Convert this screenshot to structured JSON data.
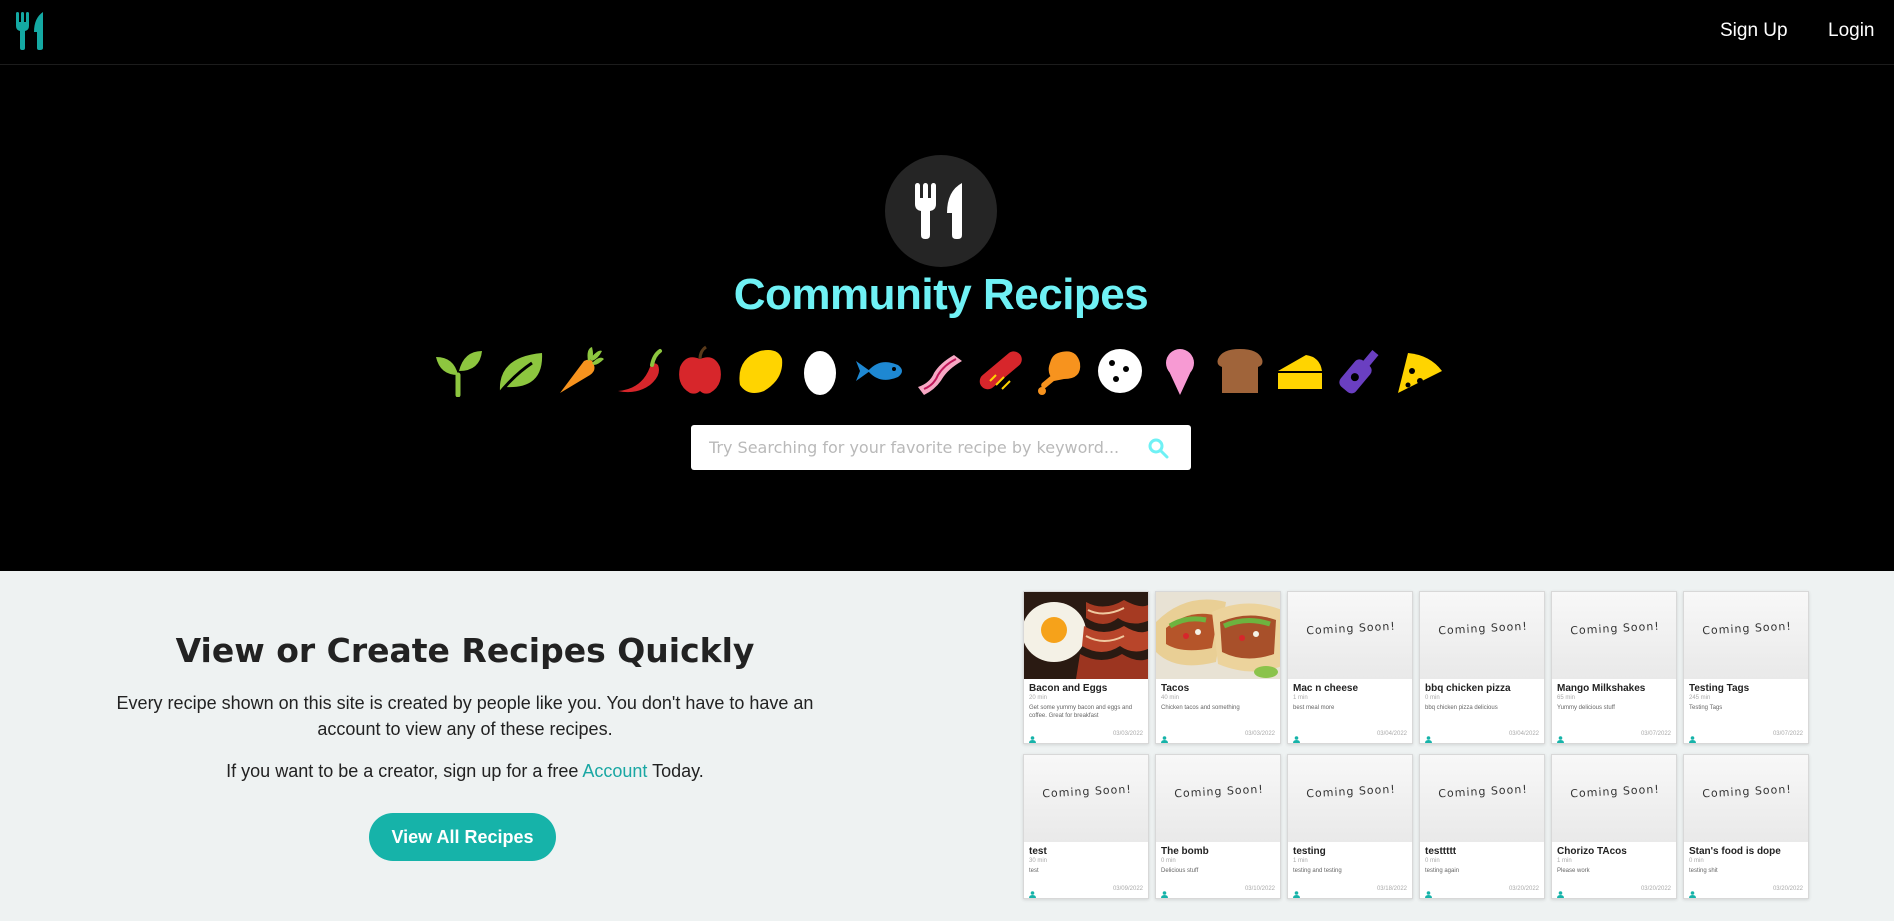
{
  "nav": {
    "signup_label": "Sign Up",
    "login_label": "Login"
  },
  "hero": {
    "title": "Community Recipes",
    "food_icons": [
      "sprout-icon",
      "leaf-icon",
      "carrot-icon",
      "chili-pepper-icon",
      "apple-icon",
      "lemon-icon",
      "egg-icon",
      "fish-icon",
      "bacon-icon",
      "hotdog-icon",
      "drumstick-icon",
      "cookie-icon",
      "ice-cream-icon",
      "bread-icon",
      "cheese-icon",
      "bottle-icon",
      "pizza-slice-icon"
    ]
  },
  "search": {
    "placeholder": "Try Searching for your favorite recipe by keyword..."
  },
  "section": {
    "title": "View or Create Recipes Quickly",
    "description": "Every recipe shown on this site is created by people like you. You don't have to have an account to view any of these recipes.",
    "cta_before": "If you want to be a creator, sign up for a free ",
    "cta_link": "Account",
    "cta_after": " Today.",
    "button_label": "View All Recipes"
  },
  "colors": {
    "accent": "#16b3a9",
    "title": "#6ff1f5",
    "hero_bg": "#000000",
    "section_bg": "#eef2f2"
  },
  "coming_soon_label": "Coming Soon!",
  "recipes": [
    {
      "title": "Bacon and Eggs",
      "time": "20 min",
      "description": "Get some yummy bacon and eggs and coffee. Great for breakfast",
      "date": "03/03/2022",
      "image": "bacon-eggs"
    },
    {
      "title": "Tacos",
      "time": "40 min",
      "description": "Chicken tacos and something",
      "date": "03/03/2022",
      "image": "tacos"
    },
    {
      "title": "Mac n cheese",
      "time": "1 min",
      "description": "best meal more",
      "date": "03/04/2022",
      "image": "coming-soon"
    },
    {
      "title": "bbq chicken pizza",
      "time": "0 min",
      "description": "bbq chicken pizza delicious",
      "date": "03/04/2022",
      "image": "coming-soon"
    },
    {
      "title": "Mango Milkshakes",
      "time": "65 min",
      "description": "Yummy delicious stuff",
      "date": "03/07/2022",
      "image": "coming-soon"
    },
    {
      "title": "Testing Tags",
      "time": "245 min",
      "description": "Testing Tags",
      "date": "03/07/2022",
      "image": "coming-soon"
    },
    {
      "title": "test",
      "time": "30 min",
      "description": "test",
      "date": "03/09/2022",
      "image": "coming-soon"
    },
    {
      "title": "The bomb",
      "time": "0 min",
      "description": "Delicious stuff",
      "date": "03/10/2022",
      "image": "coming-soon"
    },
    {
      "title": "testing",
      "time": "1 min",
      "description": "testing and testing",
      "date": "03/18/2022",
      "image": "coming-soon"
    },
    {
      "title": "testtttt",
      "time": "0 min",
      "description": "testing again",
      "date": "03/20/2022",
      "image": "coming-soon"
    },
    {
      "title": "Chorizo TAcos",
      "time": "1 min",
      "description": "Please work",
      "date": "03/20/2022",
      "image": "coming-soon"
    },
    {
      "title": "Stan's food is dope",
      "time": "0 min",
      "description": "testing shit",
      "date": "03/20/2022",
      "image": "coming-soon"
    }
  ]
}
